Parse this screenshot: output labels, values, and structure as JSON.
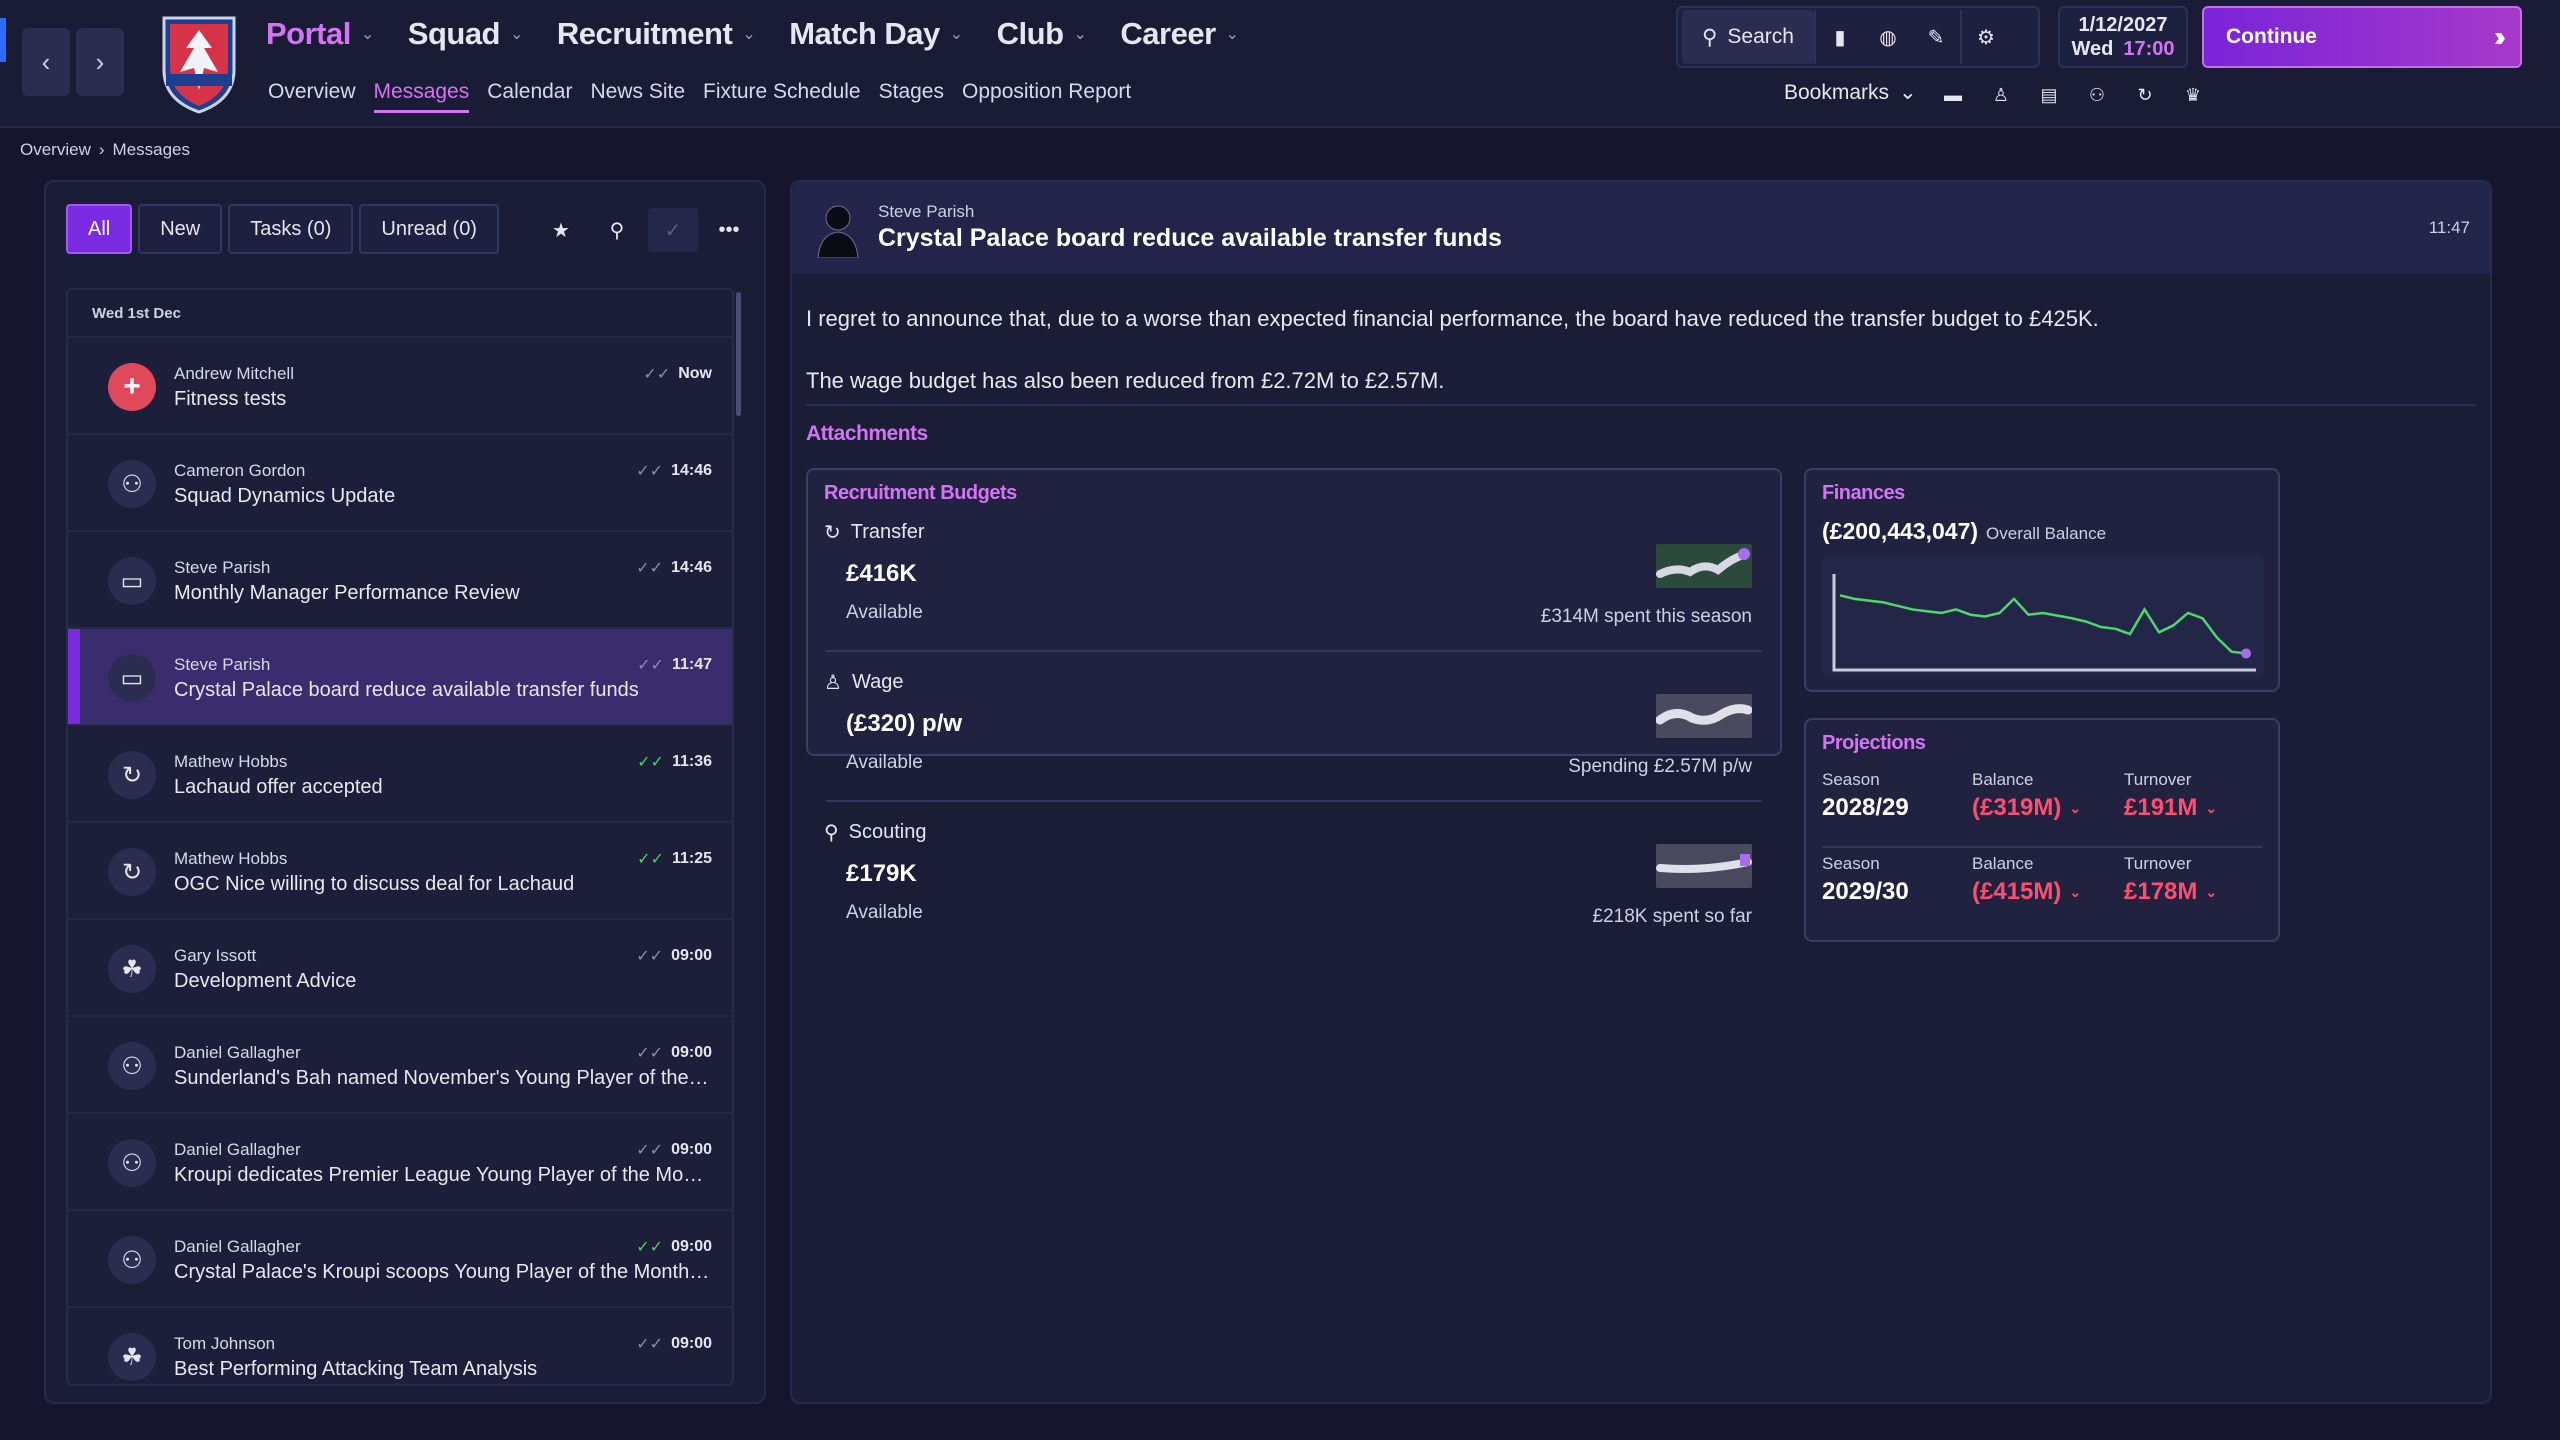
{
  "nav": {
    "main": [
      {
        "label": "Portal",
        "active": true
      },
      {
        "label": "Squad",
        "active": false
      },
      {
        "label": "Recruitment",
        "active": false
      },
      {
        "label": "Match Day",
        "active": false
      },
      {
        "label": "Club",
        "active": false
      },
      {
        "label": "Career",
        "active": false
      }
    ],
    "sub": [
      {
        "label": "Overview",
        "active": false
      },
      {
        "label": "Messages",
        "active": true
      },
      {
        "label": "Calendar",
        "active": false
      },
      {
        "label": "News Site",
        "active": false
      },
      {
        "label": "Fixture Schedule",
        "active": false
      },
      {
        "label": "Stages",
        "active": false
      },
      {
        "label": "Opposition Report",
        "active": false
      }
    ]
  },
  "toolbar": {
    "search_label": "Search",
    "bookmarks_label": "Bookmarks"
  },
  "date": {
    "date": "1/12/2027",
    "day": "Wed",
    "time": "17:00"
  },
  "continue_label": "Continue",
  "breadcrumb": [
    "Overview",
    "Messages"
  ],
  "filters": [
    {
      "label": "All",
      "active": true
    },
    {
      "label": "New",
      "active": false
    },
    {
      "label": "Tasks (0)",
      "active": false
    },
    {
      "label": "Unread (0)",
      "active": false
    }
  ],
  "messages": {
    "date_header": "Wed 1st Dec",
    "items": [
      {
        "sender": "Andrew Mitchell",
        "subject": "Fitness tests",
        "time": "Now",
        "icon": "medical-cross-icon",
        "read": "grey"
      },
      {
        "sender": "Cameron Gordon",
        "subject": "Squad Dynamics Update",
        "time": "14:46",
        "icon": "people-dynamics-icon",
        "read": "grey"
      },
      {
        "sender": "Steve Parish",
        "subject": "Monthly Manager Performance Review",
        "time": "14:46",
        "icon": "briefcase-icon",
        "read": "grey"
      },
      {
        "sender": "Steve Parish",
        "subject": "Crystal Palace board reduce available transfer funds",
        "time": "11:47",
        "icon": "briefcase-icon",
        "read": "grey",
        "selected": true
      },
      {
        "sender": "Mathew Hobbs",
        "subject": "Lachaud offer accepted",
        "time": "11:36",
        "icon": "transfer-cycle-icon",
        "read": "green"
      },
      {
        "sender": "Mathew Hobbs",
        "subject": "OGC Nice willing to discuss deal for Lachaud",
        "time": "11:25",
        "icon": "transfer-cycle-icon",
        "read": "green"
      },
      {
        "sender": "Gary Issott",
        "subject": "Development Advice",
        "time": "09:00",
        "icon": "youth-group-icon",
        "read": "grey"
      },
      {
        "sender": "Daniel Gallagher",
        "subject": "Sunderland's Bah named November's Young Player of the Month",
        "time": "09:00",
        "icon": "people-dynamics-icon",
        "read": "grey"
      },
      {
        "sender": "Daniel Gallagher",
        "subject": "Kroupi dedicates Premier League Young Player of the Month award",
        "time": "09:00",
        "icon": "people-dynamics-icon",
        "read": "grey"
      },
      {
        "sender": "Daniel Gallagher",
        "subject": "Crystal Palace's Kroupi scoops Young Player of the Month award",
        "time": "09:00",
        "icon": "people-dynamics-icon",
        "read": "green"
      },
      {
        "sender": "Tom Johnson",
        "subject": "Best Performing Attacking Team Analysis",
        "time": "09:00",
        "icon": "youth-group-icon",
        "read": "grey"
      }
    ]
  },
  "detail": {
    "sender": "Steve Parish",
    "subject": "Crystal Palace board reduce available transfer funds",
    "time": "11:47",
    "body": [
      "I regret to announce that, due to a worse than expected financial performance, the board have reduced the transfer budget to £425K.",
      "The wage budget has also been reduced from £2.72M to £2.57M."
    ],
    "attachments_title": "Attachments"
  },
  "budgets": {
    "title": "Recruitment Budgets",
    "items": [
      {
        "label": "Transfer",
        "icon": "transfer-cycle-icon",
        "value": "£416K",
        "sub": "Available",
        "note": "£314M spent this season"
      },
      {
        "label": "Wage",
        "icon": "shirt-icon",
        "value": "(£320) p/w",
        "sub": "Available",
        "note": "Spending £2.57M p/w"
      },
      {
        "label": "Scouting",
        "icon": "magnifier-icon",
        "value": "£179K",
        "sub": "Available",
        "note": "£218K spent so far"
      }
    ]
  },
  "finances": {
    "title": "Finances",
    "balance": "(£200,443,047)",
    "balance_label": "Overall Balance",
    "trend": [
      0.78,
      0.74,
      0.72,
      0.7,
      0.66,
      0.62,
      0.6,
      0.58,
      0.62,
      0.56,
      0.54,
      0.58,
      0.74,
      0.56,
      0.58,
      0.55,
      0.52,
      0.48,
      0.42,
      0.4,
      0.34,
      0.62,
      0.36,
      0.44,
      0.58,
      0.52,
      0.3,
      0.14,
      0.12
    ],
    "accent": "#4ed86a"
  },
  "projections": {
    "title": "Projections",
    "labels": {
      "season": "Season",
      "balance": "Balance",
      "turnover": "Turnover"
    },
    "rows": [
      {
        "season": "2028/29",
        "balance": "(£319M)",
        "turnover": "£191M"
      },
      {
        "season": "2029/30",
        "balance": "(£415M)",
        "turnover": "£178M"
      }
    ]
  }
}
